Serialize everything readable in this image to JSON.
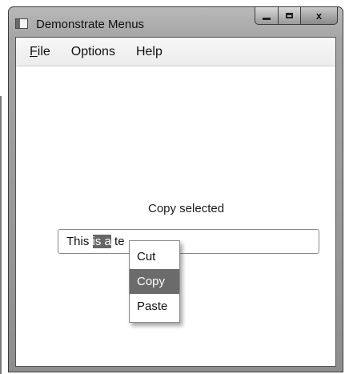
{
  "window": {
    "title": "Demonstrate Menus",
    "caption_buttons": [
      "minimize-icon",
      "maximize-icon",
      "close-icon"
    ],
    "close_glyph": "x"
  },
  "menubar": {
    "items": [
      {
        "mnemonic": "F",
        "rest": "ile"
      },
      {
        "label": "Options"
      },
      {
        "label": "Help"
      }
    ]
  },
  "main": {
    "status_label": "Copy selected",
    "textbox": {
      "before": "This ",
      "selected": "is a",
      "after": " te"
    }
  },
  "context_menu": {
    "items": [
      {
        "label": "Cut",
        "highlighted": false
      },
      {
        "label": "Copy",
        "highlighted": true
      },
      {
        "label": "Paste",
        "highlighted": false
      }
    ]
  },
  "colors": {
    "selection": "#666666",
    "menu_highlight": "#6b6b6b"
  }
}
